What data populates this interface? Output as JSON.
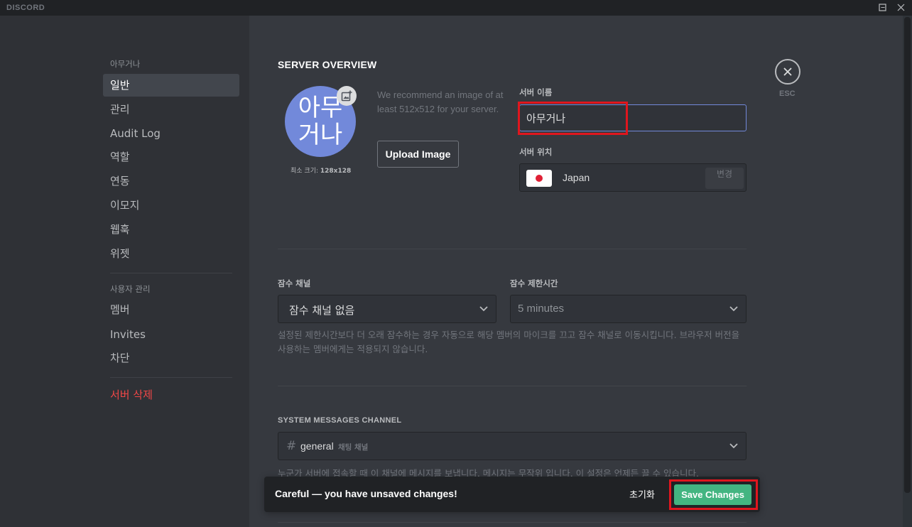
{
  "app": {
    "brand": "DISCORD"
  },
  "window_controls": {
    "minimize": "–",
    "maximize": "☐",
    "close": "✕"
  },
  "sidebar": {
    "server_header": "아무거나",
    "server_items": [
      "일반",
      "관리",
      "Audit Log",
      "역할",
      "연동",
      "이모지",
      "웹훅",
      "위젯"
    ],
    "selected": "일반",
    "user_header": "사용자 관리",
    "user_items": [
      "멤버",
      "Invites",
      "차단"
    ],
    "delete_label": "서버 삭제"
  },
  "overview": {
    "title": "SERVER OVERVIEW",
    "avatar_text": "아무거나",
    "min_size_label": "최소 크기:",
    "min_size_value": "128x128",
    "recommend_text": "We recommend an image of at least 512x512 for your server.",
    "upload_label": "Upload Image",
    "name_label": "서버 이름",
    "name_value": "아무거나",
    "region_label": "서버 위치",
    "region_value": "Japan",
    "region_change": "변경"
  },
  "afk": {
    "channel_label": "잠수 채널",
    "channel_value": "잠수 채널 없음",
    "timeout_label": "잠수 제한시간",
    "timeout_value": "5 minutes",
    "help_text": "설정된 제한시간보다 더 오래 잠수하는 경우 자동으로 해당 멤버의 마이크를 끄고 잠수 채널로 이동시킵니다. 브라우저 버전을 사용하는 멤버에게는 적용되지 않습니다."
  },
  "system": {
    "label": "SYSTEM MESSAGES CHANNEL",
    "channel_hash": "#",
    "channel_name": "general",
    "channel_category": "채팅 채널",
    "help_text": "누군가 서버에 접속할 때 이 채널에 메시지를 보냅니다. 메시지는 무작위 입니다. 이 설정은 언제든 끌 수 있습니다."
  },
  "close": {
    "esc_label": "ESC"
  },
  "notice": {
    "text": "Careful — you have unsaved changes!",
    "reset_label": "초기화",
    "save_label": "Save Changes"
  },
  "colors": {
    "blurple": "#7289da",
    "green": "#43b581",
    "danger": "#f04747",
    "highlight": "#e0161e"
  }
}
